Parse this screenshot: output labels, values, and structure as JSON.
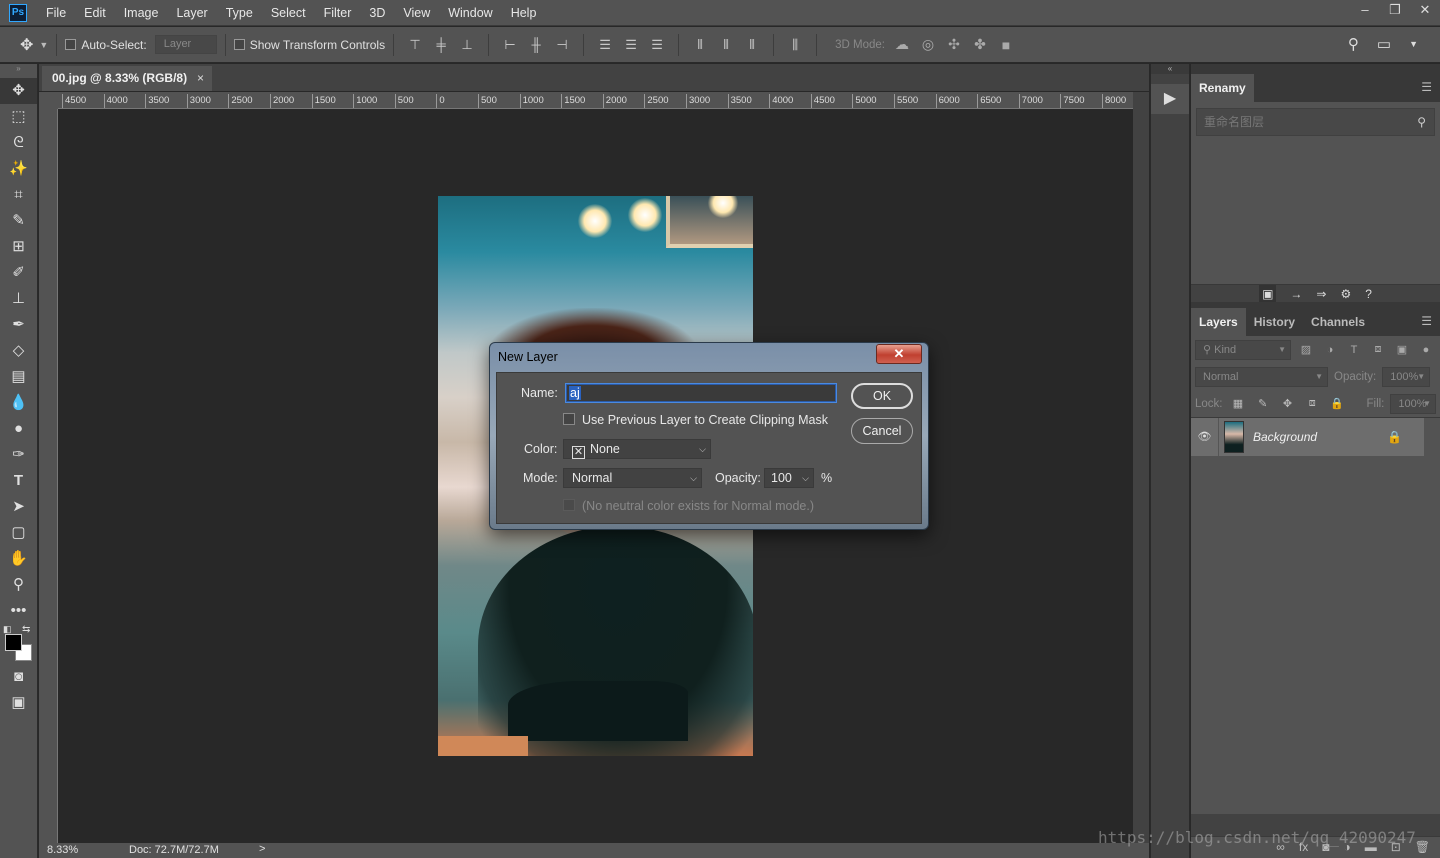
{
  "app": {
    "logo": "Ps",
    "menu": [
      "File",
      "Edit",
      "Image",
      "Layer",
      "Type",
      "Select",
      "Filter",
      "3D",
      "View",
      "Window",
      "Help"
    ],
    "window_controls": [
      "–",
      "❐",
      "✕"
    ]
  },
  "options_bar": {
    "auto_select_label": "Auto-Select:",
    "auto_select_target": "Layer",
    "show_transform_label": "Show Transform Controls",
    "mode_3d_label": "3D Mode:"
  },
  "document": {
    "tab_title": "00.jpg @ 8.33% (RGB/8)",
    "tab_close": "×",
    "ruler_marks": [
      "4500",
      "4000",
      "3500",
      "3000",
      "2500",
      "2000",
      "1500",
      "1000",
      "500",
      "0",
      "500",
      "1000",
      "1500",
      "2000",
      "2500",
      "3000",
      "3500",
      "4000",
      "4500",
      "5000",
      "5500",
      "6000",
      "6500",
      "7000",
      "7500",
      "8000"
    ],
    "zoom": "8.33%",
    "doc_size": "Doc: 72.7M/72.7M",
    "status_arrow": ">"
  },
  "rename_panel": {
    "tab": "Renamy",
    "search_placeholder": "重命名图层"
  },
  "layers_panel": {
    "tabs": [
      "Layers",
      "History",
      "Channels"
    ],
    "kind_label": "Kind",
    "blend_mode": "Normal",
    "opacity_label": "Opacity:",
    "opacity_value": "100%",
    "lock_label": "Lock:",
    "fill_label": "Fill:",
    "fill_value": "100%",
    "layers": [
      {
        "name": "Background",
        "visible": true,
        "locked": true
      }
    ]
  },
  "dialog": {
    "title": "New Layer",
    "close": "✕",
    "name_label": "Name:",
    "name_value": "aj",
    "clipping_label": "Use Previous Layer to Create Clipping Mask",
    "color_label": "Color:",
    "color_value": "None",
    "mode_label": "Mode:",
    "mode_value": "Normal",
    "opacity_label": "Opacity:",
    "opacity_value": "100",
    "percent": "%",
    "neutral_note": "(No neutral color exists for Normal mode.)",
    "ok_label": "OK",
    "cancel_label": "Cancel"
  },
  "watermark": "https://blog.csdn.net/qq_42090247",
  "colors": {
    "panel": "#535353",
    "canvas": "#282828",
    "dialog_title": "#98a8b8",
    "accent_blue": "#4a8ae0"
  }
}
